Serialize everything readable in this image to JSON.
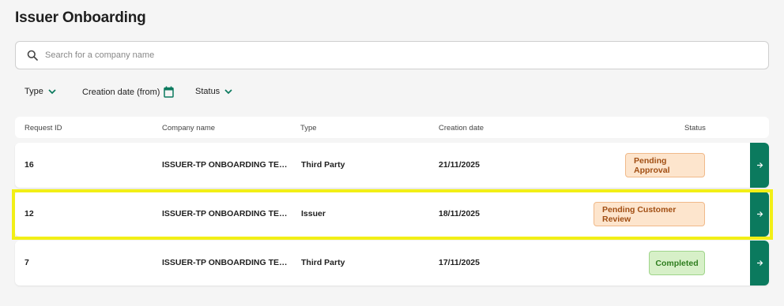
{
  "page": {
    "title": "Issuer Onboarding"
  },
  "search": {
    "placeholder": "Search for a company name",
    "value": ""
  },
  "filters": {
    "type_label": "Type",
    "date_label": "Creation date (from)",
    "status_label": "Status"
  },
  "table": {
    "columns": {
      "request_id": "Request ID",
      "company_name": "Company name",
      "type": "Type",
      "creation_date": "Creation date",
      "status": "Status"
    },
    "rows": [
      {
        "request_id": "16",
        "company_name": "ISSUER-TP ONBOARDING TEST E...",
        "type": "Third Party",
        "creation_date": "21/11/2025",
        "status": "Pending Approval",
        "status_kind": "pending"
      },
      {
        "request_id": "12",
        "company_name": "ISSUER-TP ONBOARDING TEST E...",
        "type": "Issuer",
        "creation_date": "18/11/2025",
        "status": "Pending Customer Review",
        "status_kind": "pending",
        "highlighted": true
      },
      {
        "request_id": "7",
        "company_name": "ISSUER-TP ONBOARDING TEST E...",
        "type": "Third Party",
        "creation_date": "17/11/2025",
        "status": "Completed",
        "status_kind": "completed"
      }
    ]
  },
  "colors": {
    "accent": "#0b7a5e",
    "pending_bg": "#fde5cd",
    "pending_text": "#a14e13",
    "completed_bg": "#d7f0c8",
    "completed_text": "#2e7d1e",
    "highlight": "#f2ef16"
  },
  "icons": {
    "search": "search-icon",
    "chevron": "chevron-down-icon",
    "calendar": "calendar-icon",
    "arrow": "arrow-right-icon"
  }
}
